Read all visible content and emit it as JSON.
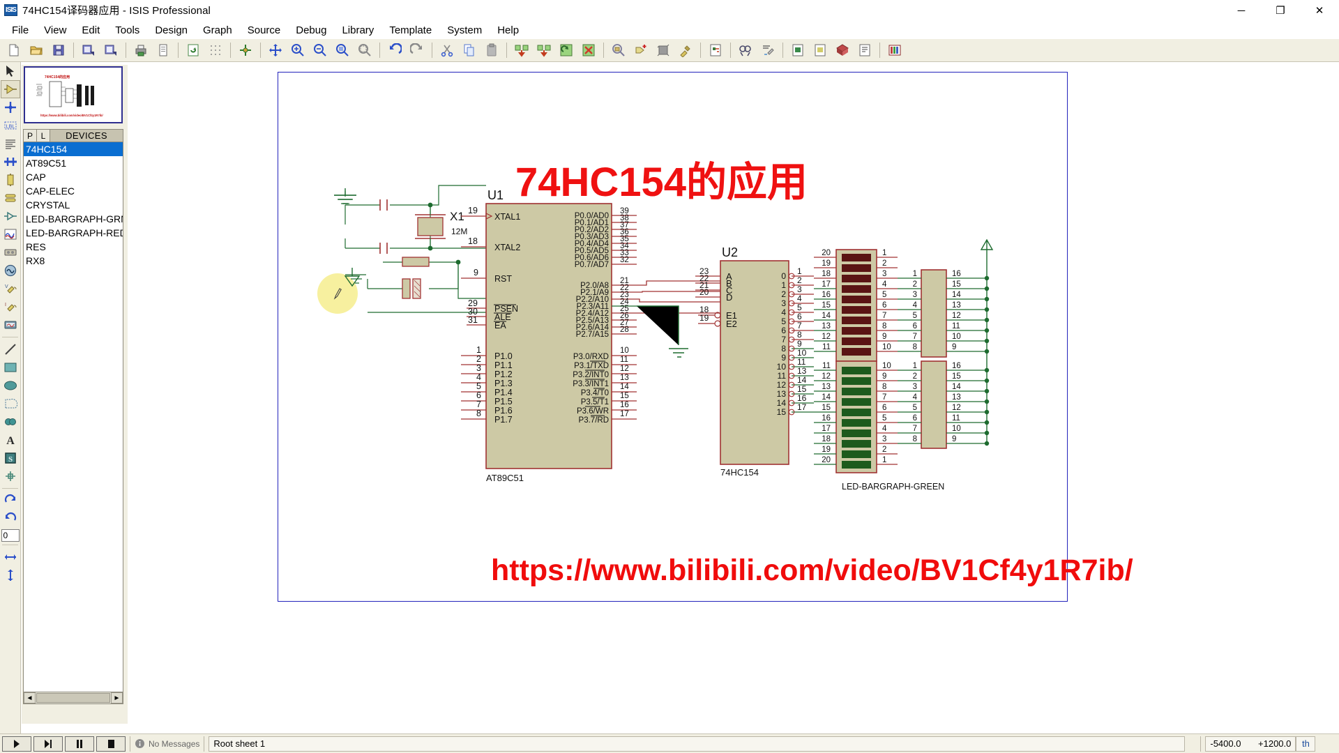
{
  "window": {
    "title": "74HC154译码器应用 - ISIS Professional",
    "app_icon": "isis-icon",
    "icon_text": "ISIS",
    "minimize": "─",
    "maximize": "❐",
    "close": "✕"
  },
  "menu": {
    "items": [
      {
        "label": "File",
        "name": "menu-file"
      },
      {
        "label": "View",
        "name": "menu-view"
      },
      {
        "label": "Edit",
        "name": "menu-edit"
      },
      {
        "label": "Tools",
        "name": "menu-tools"
      },
      {
        "label": "Design",
        "name": "menu-design"
      },
      {
        "label": "Graph",
        "name": "menu-graph"
      },
      {
        "label": "Source",
        "name": "menu-source"
      },
      {
        "label": "Debug",
        "name": "menu-debug"
      },
      {
        "label": "Library",
        "name": "menu-library"
      },
      {
        "label": "Template",
        "name": "menu-template"
      },
      {
        "label": "System",
        "name": "menu-system"
      },
      {
        "label": "Help",
        "name": "menu-help"
      }
    ]
  },
  "toolbar": {
    "groups": [
      [
        "new-file-icon",
        "open-file-icon",
        "save-file-icon"
      ],
      [
        "import-section-icon",
        "export-section-icon"
      ],
      [
        "print-icon",
        "print-area-icon"
      ],
      [
        "refresh-display-icon",
        "toggle-grid-icon"
      ],
      [
        "origin-icon"
      ],
      [
        "pan-icon",
        "zoom-in-icon",
        "zoom-out-icon",
        "zoom-area-icon",
        "zoom-all-icon"
      ],
      [
        "undo-icon",
        "redo-icon"
      ],
      [
        "cut-icon",
        "copy-icon",
        "paste-icon"
      ],
      [
        "block-copy-icon",
        "block-move-icon",
        "block-rotate-icon",
        "block-delete-icon"
      ],
      [
        "pick-device-icon",
        "make-device-icon",
        "packaging-tool-icon",
        "decompose-icon"
      ],
      [
        "netlist-icon"
      ],
      [
        "electrical-rules-icon",
        "netlist-compiler-icon"
      ],
      [
        "ares-netlist-icon",
        "ares-layout-icon",
        "3d-viewer-icon",
        "bom-report-icon"
      ],
      [
        "design-explorer-icon",
        "property-assign-icon"
      ],
      [
        "bill-of-materials-icon"
      ]
    ]
  },
  "left_tools": {
    "items": [
      {
        "name": "selection-mode-icon",
        "label": "Selection Mode",
        "selected": false
      },
      {
        "name": "component-mode-icon",
        "label": "Component Mode",
        "selected": true
      },
      {
        "name": "junction-dot-icon",
        "label": "Junction Dot Mode",
        "selected": false
      },
      {
        "name": "wire-label-icon",
        "label": "Wire Label Mode",
        "selected": false
      },
      {
        "name": "text-script-icon",
        "label": "Text Script Mode",
        "selected": false
      },
      {
        "name": "bus-mode-icon",
        "label": "Buses Mode",
        "selected": false
      },
      {
        "name": "subcircuit-icon",
        "label": "Subcircuit Mode",
        "selected": false
      },
      {
        "name": "terminals-icon",
        "label": "Terminals Mode",
        "selected": false
      },
      {
        "name": "device-pin-icon",
        "label": "Device Pins Mode",
        "selected": false
      },
      {
        "name": "graph-mode-icon",
        "label": "Graph Mode",
        "selected": false
      },
      {
        "name": "tape-recorder-icon",
        "label": "Tape Recorder Mode",
        "selected": false
      },
      {
        "name": "generator-icon",
        "label": "Generator Mode",
        "selected": false
      },
      {
        "name": "voltage-probe-icon",
        "label": "Voltage Probe Mode",
        "selected": false
      },
      {
        "name": "current-probe-icon",
        "label": "Current Probe Mode",
        "selected": false
      },
      {
        "name": "virtual-instrument-icon",
        "label": "Virtual Instruments Mode",
        "selected": false
      },
      {
        "name": "line-tool-icon",
        "label": "2D Line",
        "selected": false
      },
      {
        "name": "box-tool-icon",
        "label": "2D Box",
        "selected": false
      },
      {
        "name": "circle-tool-icon",
        "label": "2D Circle",
        "selected": false
      },
      {
        "name": "arc-tool-icon",
        "label": "2D Arc",
        "selected": false
      },
      {
        "name": "path-tool-icon",
        "label": "2D Closed Path",
        "selected": false
      },
      {
        "name": "text-tool-icon",
        "label": "2D Text",
        "selected": false
      },
      {
        "name": "symbol-tool-icon",
        "label": "2D Symbol",
        "selected": false
      },
      {
        "name": "marker-tool-icon",
        "label": "2D Markers",
        "selected": false
      },
      {
        "name": "rotate-clockwise-icon",
        "label": "Rotate Clockwise",
        "selected": false
      },
      {
        "name": "rotate-counterclockwise-icon",
        "label": "Rotate Anticlockwise",
        "selected": false
      }
    ],
    "rotation_value": "0"
  },
  "object_selector": {
    "header": {
      "p_label": "P",
      "l_label": "L",
      "title": "DEVICES"
    },
    "devices": [
      {
        "label": "74HC154",
        "selected": true
      },
      {
        "label": "AT89C51",
        "selected": false
      },
      {
        "label": "CAP",
        "selected": false
      },
      {
        "label": "CAP-ELEC",
        "selected": false
      },
      {
        "label": "CRYSTAL",
        "selected": false
      },
      {
        "label": "LED-BARGRAPH-GRN",
        "selected": false
      },
      {
        "label": "LED-BARGRAPH-RED",
        "selected": false
      },
      {
        "label": "RES",
        "selected": false
      },
      {
        "label": "RX8",
        "selected": false
      }
    ],
    "scroll_left": "◄",
    "scroll_right": "►"
  },
  "schematic": {
    "heading": "74HC154的应用",
    "url": "https://www.bilibili.com/video/BV1Cf4y1R7ib/",
    "components": {
      "u1": {
        "reference": "U1",
        "value": "AT89C51",
        "left_pins": [
          {
            "num": "19",
            "label": "XTAL1"
          },
          {
            "num": "18",
            "label": "XTAL2"
          },
          {
            "num": "9",
            "label": "RST"
          },
          {
            "num": "29",
            "label": "PSEN"
          },
          {
            "num": "30",
            "label": "ALE"
          },
          {
            "num": "31",
            "label": "EA"
          },
          {
            "num": "1",
            "label": "P1.0"
          },
          {
            "num": "2",
            "label": "P1.1"
          },
          {
            "num": "3",
            "label": "P1.2"
          },
          {
            "num": "4",
            "label": "P1.3"
          },
          {
            "num": "5",
            "label": "P1.4"
          },
          {
            "num": "6",
            "label": "P1.5"
          },
          {
            "num": "7",
            "label": "P1.6"
          },
          {
            "num": "8",
            "label": "P1.7"
          }
        ],
        "right_pins_p0": [
          {
            "num": "39",
            "label": "P0.0/AD0"
          },
          {
            "num": "38",
            "label": "P0.1/AD1"
          },
          {
            "num": "37",
            "label": "P0.2/AD2"
          },
          {
            "num": "36",
            "label": "P0.3/AD3"
          },
          {
            "num": "35",
            "label": "P0.4/AD4"
          },
          {
            "num": "34",
            "label": "P0.5/AD5"
          },
          {
            "num": "33",
            "label": "P0.6/AD6"
          },
          {
            "num": "32",
            "label": "P0.7/AD7"
          }
        ],
        "right_pins_p2": [
          {
            "num": "21",
            "label": "P2.0/A8"
          },
          {
            "num": "22",
            "label": "P2.1/A9"
          },
          {
            "num": "23",
            "label": "P2.2/A10"
          },
          {
            "num": "24",
            "label": "P2.3/A11"
          },
          {
            "num": "25",
            "label": "P2.4/A12"
          },
          {
            "num": "26",
            "label": "P2.5/A13"
          },
          {
            "num": "27",
            "label": "P2.6/A14"
          },
          {
            "num": "28",
            "label": "P2.7/A15"
          }
        ],
        "right_pins_p3": [
          {
            "num": "10",
            "label": "P3.0/RXD"
          },
          {
            "num": "11",
            "label": "P3.1/TXD"
          },
          {
            "num": "12",
            "label": "P3.2/INT0"
          },
          {
            "num": "13",
            "label": "P3.3/INT1"
          },
          {
            "num": "14",
            "label": "P3.4/T0"
          },
          {
            "num": "15",
            "label": "P3.5/T1"
          },
          {
            "num": "16",
            "label": "P3.6/WR"
          },
          {
            "num": "17",
            "label": "P3.7/RD"
          }
        ]
      },
      "u2": {
        "reference": "U2",
        "value": "74HC154",
        "inputs": [
          {
            "num": "23",
            "label": "A"
          },
          {
            "num": "22",
            "label": "B"
          },
          {
            "num": "21",
            "label": "C"
          },
          {
            "num": "20",
            "label": "D"
          }
        ],
        "enables": [
          {
            "num": "18",
            "label": "E1"
          },
          {
            "num": "19",
            "label": "E2"
          }
        ],
        "outputs": [
          {
            "label": "0",
            "num": "1"
          },
          {
            "label": "1",
            "num": "2"
          },
          {
            "label": "2",
            "num": "3"
          },
          {
            "label": "3",
            "num": "4"
          },
          {
            "label": "4",
            "num": "5"
          },
          {
            "label": "5",
            "num": "6"
          },
          {
            "label": "6",
            "num": "7"
          },
          {
            "label": "7",
            "num": "8"
          },
          {
            "label": "8",
            "num": "9"
          },
          {
            "label": "9",
            "num": "10"
          },
          {
            "label": "10",
            "num": "11"
          },
          {
            "label": "11",
            "num": "13"
          },
          {
            "label": "12",
            "num": "14"
          },
          {
            "label": "13",
            "num": "15"
          },
          {
            "label": "14",
            "num": "16"
          },
          {
            "label": "15",
            "num": "17"
          }
        ]
      },
      "crystal": {
        "reference": "X1",
        "value": "12M"
      },
      "bargraph": {
        "label": "LED-BARGRAPH-GREEN",
        "red_left_pins": [
          "20",
          "19",
          "18",
          "17",
          "16",
          "15",
          "14",
          "13",
          "12",
          "11"
        ],
        "red_right_pins": [
          "1",
          "2",
          "3",
          "4",
          "5",
          "6",
          "7",
          "8",
          "9",
          "10"
        ],
        "green_left_pins": [
          "11",
          "12",
          "13",
          "14",
          "15",
          "16",
          "17",
          "18",
          "19",
          "20"
        ],
        "green_right_pins": [
          "10",
          "9",
          "8",
          "7",
          "6",
          "5",
          "4",
          "3",
          "2",
          "1"
        ]
      },
      "rx8_top": {
        "left_pins": [
          "1",
          "2",
          "3",
          "4",
          "5",
          "6",
          "7",
          "8"
        ],
        "right_pins": [
          "16",
          "15",
          "14",
          "13",
          "12",
          "11",
          "10",
          "9"
        ]
      },
      "rx8_bottom": {
        "left_pins": [
          "1",
          "2",
          "3",
          "4",
          "5",
          "6",
          "7",
          "8"
        ],
        "right_pins": [
          "16",
          "15",
          "14",
          "13",
          "12",
          "11",
          "10",
          "9"
        ]
      }
    }
  },
  "statusbar": {
    "sim_buttons": [
      {
        "name": "sim-play-button",
        "glyph": "▶"
      },
      {
        "name": "sim-step-button",
        "glyph": "❚▶"
      },
      {
        "name": "sim-pause-button",
        "glyph": "❚❚"
      },
      {
        "name": "sim-stop-button",
        "glyph": "■"
      }
    ],
    "message": "No Messages",
    "message_icon": "info-icon",
    "sheet": "Root sheet 1",
    "coord_x": "-5400.0",
    "coord_y": "+1200.0",
    "units": "th"
  },
  "colors": {
    "accent_red": "#ef1111",
    "selection_blue": "#0a6ed1",
    "wire_green": "#1d6b2f",
    "pin_red": "#a03232",
    "body_fill": "#cdc9a5",
    "sheet_border": "#2222bb",
    "led_red": "#5a1414",
    "led_green": "#1d5a1d"
  }
}
